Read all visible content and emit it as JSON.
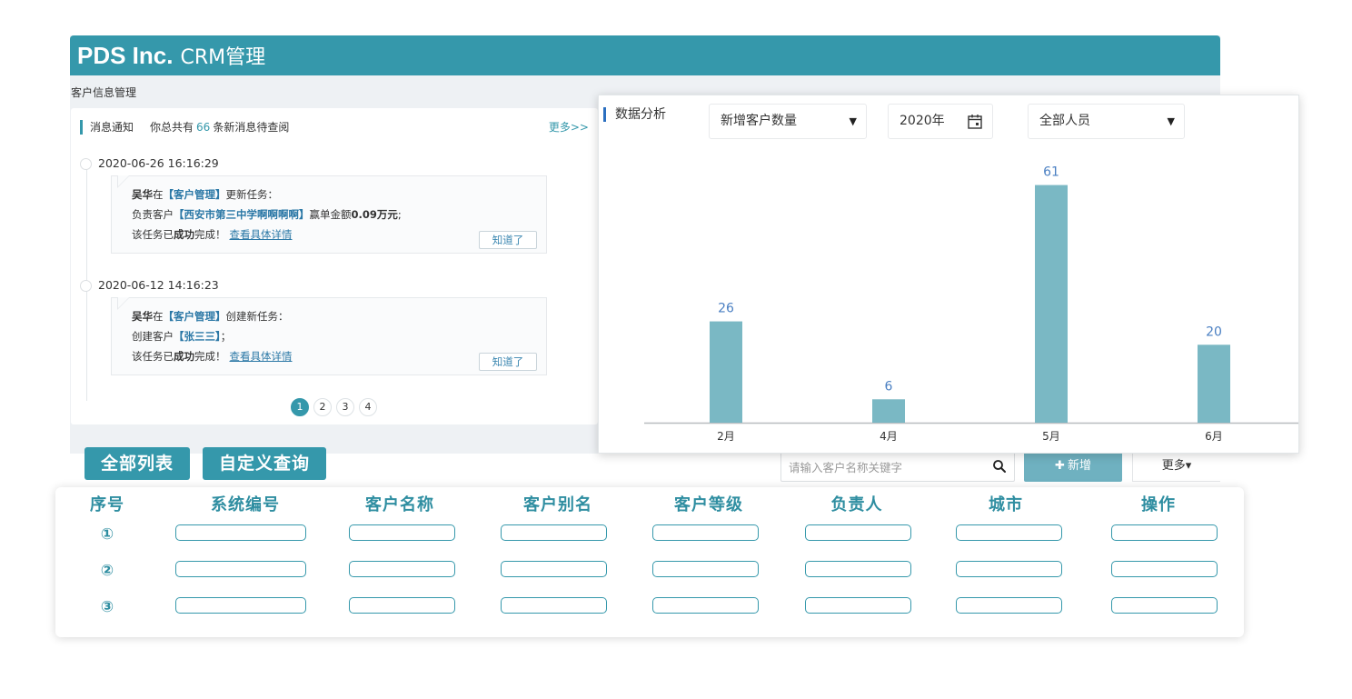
{
  "app": {
    "brand": "PDS Inc.",
    "title_suffix": "CRM管理",
    "breadcrumb": "客户信息管理"
  },
  "messages": {
    "title": "消息通知",
    "summary_prefix": "你总共有",
    "count": "66",
    "summary_suffix": "条新消息待查阅",
    "more_link": "更多>>",
    "items": [
      {
        "time": "2020-06-26 16:16:29",
        "actor": "吴华",
        "at": "在",
        "module": "【客户管理】",
        "action": "更新任务：",
        "line2_prefix": "负责客户",
        "customer": "【西安市第三中学啊啊啊啊】",
        "line2_mid": "赢单金额",
        "amount": "0.09万元",
        "line2_end": ";",
        "line3_prefix": "该任务已",
        "status": "成功",
        "line3_suffix": "完成！",
        "detail_link": "查看具体详情",
        "ack_button": "知道了"
      },
      {
        "time": "2020-06-12 14:16:23",
        "actor": "吴华",
        "at": "在",
        "module": "【客户管理】",
        "action": "创建新任务：",
        "line2_prefix": "创建客户",
        "customer": "【张三三】",
        "line2_end": "；",
        "line3_prefix": "该任务已",
        "status": "成功",
        "line3_suffix": "完成！",
        "detail_link": "查看具体详情",
        "ack_button": "知道了"
      }
    ],
    "pages": [
      "1",
      "2",
      "3",
      "4"
    ],
    "active_page": "1"
  },
  "toolbar": {
    "all_list": "全部列表",
    "custom_query": "自定义查询",
    "search_placeholder": "请输入客户名称关键字",
    "add_button": "新增",
    "add_icon": "plus-icon",
    "more_button": "更多▾"
  },
  "analysis": {
    "title": "数据分析",
    "metric_select": "新增客户数量",
    "year_select": "2020年",
    "people_select": "全部人员",
    "caret": "▼"
  },
  "chart_data": {
    "type": "bar",
    "categories": [
      "2月",
      "4月",
      "5月",
      "6月"
    ],
    "values": [
      26,
      6,
      61,
      20
    ],
    "ylim": [
      0,
      70
    ],
    "grid": false,
    "bar_color": "#7ab8c4",
    "label_color": "#4a7fc2"
  },
  "table": {
    "headers": [
      "序号",
      "系统编号",
      "客户名称",
      "客户别名",
      "客户等级",
      "负责人",
      "城市",
      "操作"
    ],
    "rows": [
      "①",
      "②",
      "③"
    ]
  },
  "colors": {
    "primary": "#3598ab",
    "header_text": "#2f8ea1",
    "link": "#2b78a6"
  }
}
